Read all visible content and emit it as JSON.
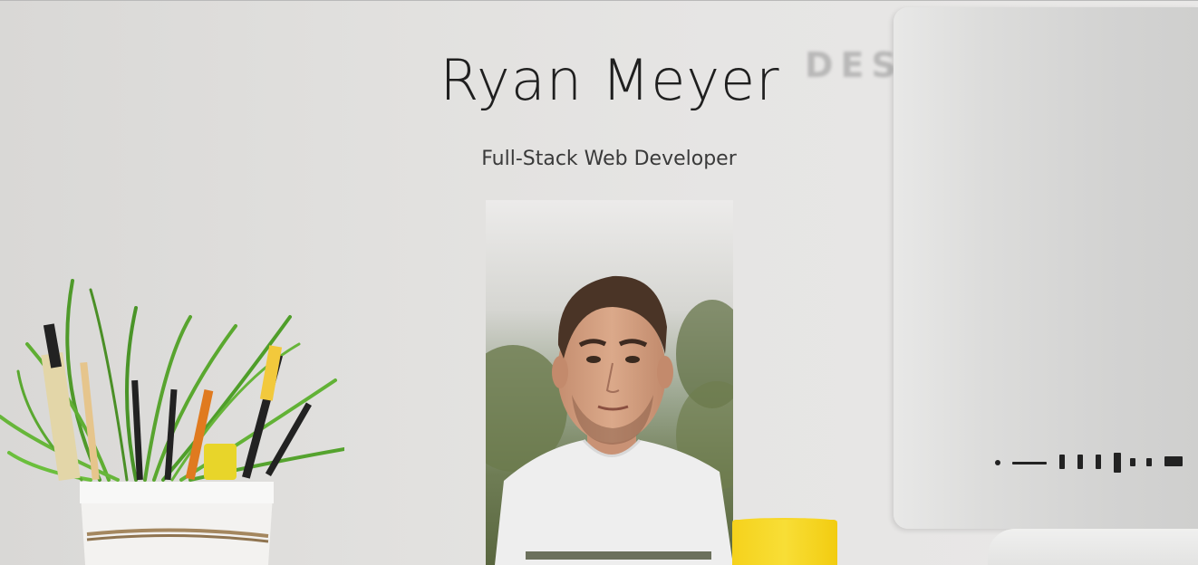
{
  "hero": {
    "name": "Ryan Meyer",
    "subtitle": "Full-Stack Web Developer",
    "backdrop_text": "DES"
  },
  "images": {
    "portrait": "portrait-photo",
    "monitor": "desktop-monitor",
    "plant": "plant-and-pencils",
    "mug": "yellow-mug"
  },
  "colors": {
    "title": "#1f1f1f",
    "subtitle": "#3a3a3a",
    "mug": "#f5d21c"
  }
}
